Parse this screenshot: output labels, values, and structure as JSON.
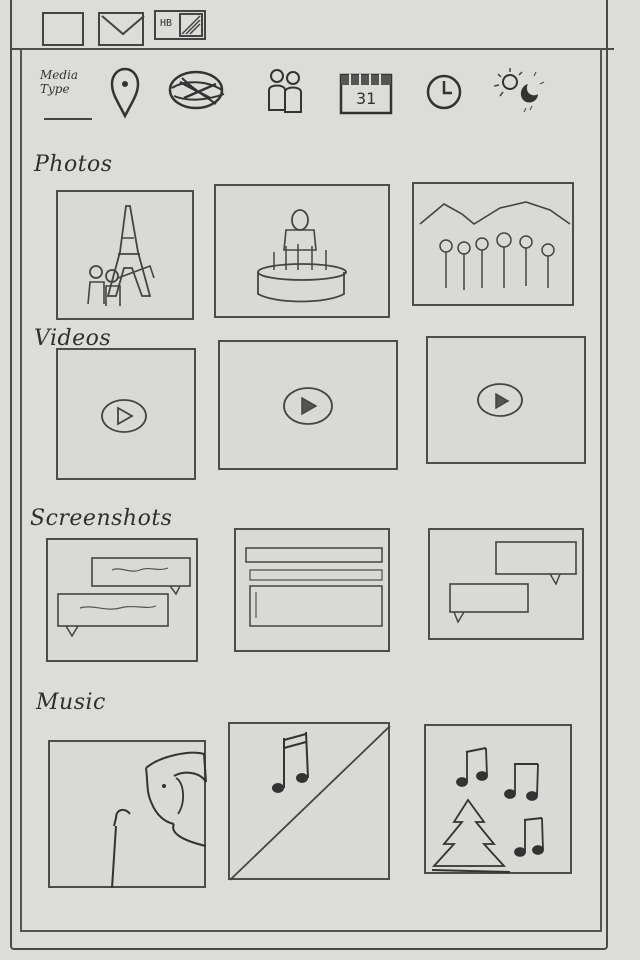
{
  "filters": {
    "media_type_label": "Media Type",
    "icons": [
      "location-pin-icon",
      "globe-icon",
      "people-icon",
      "calendar-icon",
      "clock-icon",
      "weather-icon"
    ],
    "calendar_day": "31"
  },
  "top_icons": [
    "window-icon",
    "mail-icon",
    "storage-icon"
  ],
  "storage_badge": "HB",
  "sections": {
    "photos": {
      "title": "Photos"
    },
    "videos": {
      "title": "Videos"
    },
    "screenshots": {
      "title": "Screenshots"
    },
    "music": {
      "title": "Music"
    }
  }
}
